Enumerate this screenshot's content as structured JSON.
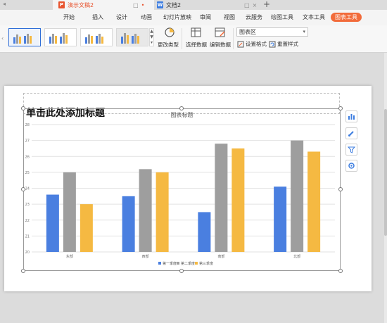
{
  "tabs": [
    {
      "title": "演示文稿2",
      "icon_color": "#e8542f",
      "icon_glyph": "P",
      "active": true
    },
    {
      "title": "文档2",
      "icon_color": "#3d7de0",
      "icon_glyph": "W",
      "active": false
    }
  ],
  "tab_controls": {
    "monitor": "□",
    "modified_dot": "•",
    "close": "×",
    "new_tab": "+"
  },
  "ribbon_tabs": [
    "开始",
    "插入",
    "设计",
    "动画",
    "幻灯片放映",
    "审阅",
    "视图",
    "云服务",
    "绘图工具",
    "文本工具",
    "图表工具"
  ],
  "ribbon_active": "图表工具",
  "toolbar": {
    "change_type_label": "更改类型",
    "select_data_label": "选择数据",
    "edit_data_label": "编辑数据",
    "chart_area_combo": "图表区",
    "set_format_label": "设置格式",
    "reset_style_label": "重置样式"
  },
  "slide": {
    "title_placeholder": "单击此处添加标题"
  },
  "chart_data": {
    "type": "bar",
    "title": "图表标题",
    "categories": [
      "东部",
      "西部",
      "南部",
      "北部"
    ],
    "series": [
      {
        "name": "第一季度",
        "color": "#4a7fe0",
        "values": [
          23.6,
          23.5,
          22.5,
          24.1
        ]
      },
      {
        "name": "第二季度",
        "color": "#9e9e9e",
        "values": [
          25.0,
          25.2,
          26.8,
          27.0
        ]
      },
      {
        "name": "第三季度",
        "color": "#f5b942",
        "values": [
          23.0,
          25.0,
          26.5,
          26.3
        ]
      }
    ],
    "ylim": [
      20,
      28
    ],
    "yticks": [
      20,
      21,
      22,
      23,
      24,
      25,
      26,
      27,
      28
    ],
    "grid": true,
    "legend": "bottom"
  }
}
